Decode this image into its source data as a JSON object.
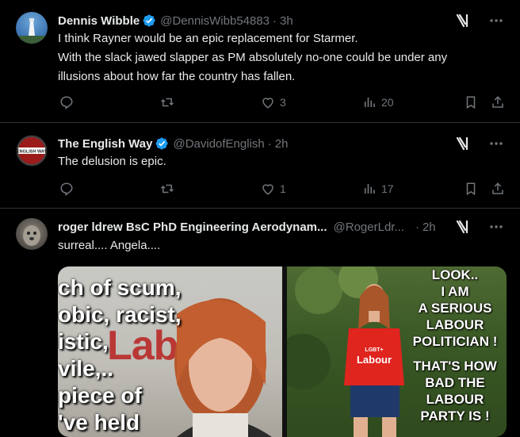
{
  "tweets": [
    {
      "name": "Dennis Wibble",
      "handle": "@DennisWibb54883",
      "sep": "·",
      "time": "3h",
      "text_lines": [
        "I think Rayner would be an epic replacement for Starmer.",
        "With the slack jawed slapper as PM absolutely no-one could be under any",
        "illusions about how far the country has fallen."
      ],
      "replies": "",
      "retweets": "",
      "likes": "3",
      "views": "20"
    },
    {
      "name": "The English Way",
      "handle": "@DavidofEnglish",
      "sep": "·",
      "time": "2h",
      "avatar_text": "ENGLISH WAY",
      "text_lines": [
        "The delusion is epic."
      ],
      "likes": "1",
      "views": "17"
    },
    {
      "name": "roger ldrew BsC PhD Engineering Aerodynam...",
      "handle": "@RogerLdr...",
      "sep": "·",
      "time": "2h",
      "text_lines": [
        "surreal.... Angela...."
      ],
      "media": {
        "left_image_text": [
          "ch of scum,",
          "obic, racist,",
          "istic,",
          " vile,..",
          "piece of",
          "'ve held"
        ],
        "left_image_logo": "Labour",
        "right_image_text": [
          "LOOK..",
          "I AM",
          "A SERIOUS",
          "LABOUR",
          "POLITICIAN !",
          "",
          "THAT'S HOW",
          "BAD THE",
          "LABOUR",
          "PARTY IS !"
        ],
        "right_image_shirt": "Labour",
        "right_image_shirt_tag": "LGBT+"
      }
    }
  ],
  "colors": {
    "background": "#000000",
    "text": "#e7e9ea",
    "muted": "#71767b",
    "verified": "#1d9bf0",
    "divider": "#2f3336"
  },
  "icons": [
    "grok-icon",
    "more-icon",
    "reply-icon",
    "retweet-icon",
    "like-icon",
    "views-icon",
    "bookmark-icon",
    "share-icon",
    "verified-badge-icon"
  ]
}
